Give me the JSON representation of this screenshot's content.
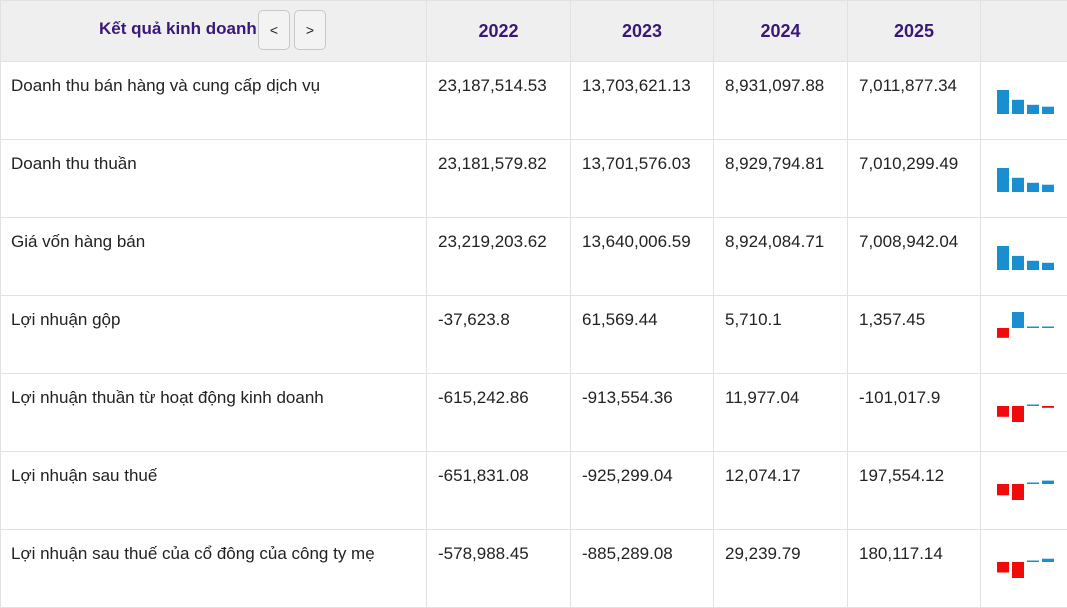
{
  "header": {
    "title": "Kết quả kinh doanh",
    "prev_label": "<",
    "next_label": ">",
    "years": [
      "2022",
      "2023",
      "2024",
      "2025"
    ]
  },
  "rows": [
    {
      "label": "Doanh thu bán hàng và cung cấp dịch vụ",
      "values": [
        "23,187,514.53",
        "13,703,621.13",
        "8,931,097.88",
        "7,011,877.34"
      ],
      "series": [
        23187514.53,
        13703621.13,
        8931097.88,
        7011877.34
      ]
    },
    {
      "label": "Doanh thu thuần",
      "values": [
        "23,181,579.82",
        "13,701,576.03",
        "8,929,794.81",
        "7,010,299.49"
      ],
      "series": [
        23181579.82,
        13701576.03,
        8929794.81,
        7010299.49
      ]
    },
    {
      "label": "Giá vốn hàng bán",
      "values": [
        "23,219,203.62",
        "13,640,006.59",
        "8,924,084.71",
        "7,008,942.04"
      ],
      "series": [
        23219203.62,
        13640006.59,
        8924084.71,
        7008942.04
      ]
    },
    {
      "label": "Lợi nhuận gộp",
      "values": [
        "-37,623.8",
        "61,569.44",
        "5,710.1",
        "1,357.45"
      ],
      "series": [
        -37623.8,
        61569.44,
        5710.1,
        1357.45
      ]
    },
    {
      "label": "Lợi nhuận thuần từ hoạt động kinh doanh",
      "values": [
        "-615,242.86",
        "-913,554.36",
        "11,977.04",
        "-101,017.9"
      ],
      "series": [
        -615242.86,
        -913554.36,
        11977.04,
        -101017.9
      ]
    },
    {
      "label": "Lợi nhuận sau thuế",
      "values": [
        "-651,831.08",
        "-925,299.04",
        "12,074.17",
        "197,554.12"
      ],
      "series": [
        -651831.08,
        -925299.04,
        12074.17,
        197554.12
      ]
    },
    {
      "label": "Lợi nhuận sau thuế của cổ đông của công ty mẹ",
      "values": [
        "-578,988.45",
        "-885,289.08",
        "29,239.79",
        "180,117.14"
      ],
      "series": [
        -578988.45,
        -885289.08,
        29239.79,
        180117.14
      ]
    }
  ],
  "colors": {
    "positive": "#1a8fd0",
    "negative": "#f00a0a",
    "header_text": "#3b1877",
    "header_bg": "#efefef"
  }
}
